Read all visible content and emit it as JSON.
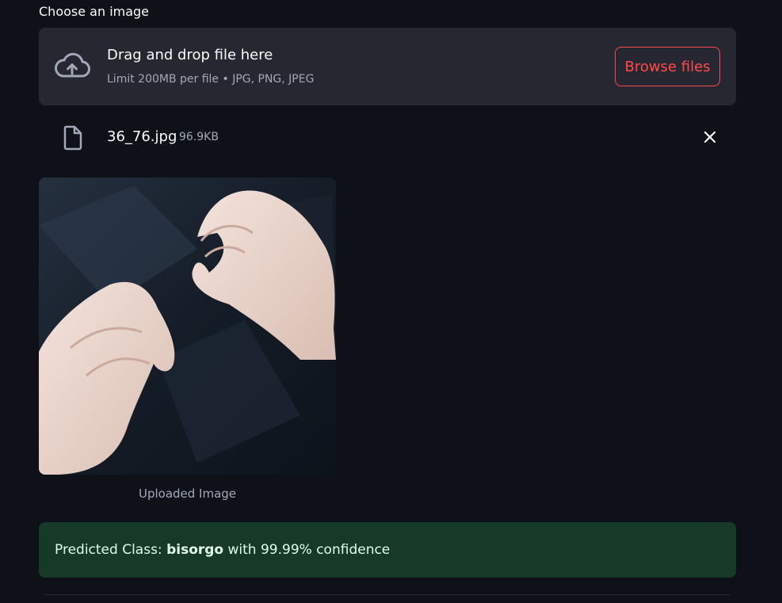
{
  "uploader": {
    "label": "Choose an image",
    "dropzone_title": "Drag and drop file here",
    "dropzone_subtitle": "Limit 200MB per file • JPG, PNG, JPEG",
    "browse_label": "Browse files",
    "accent_color": "#ff4b4b"
  },
  "file": {
    "name": "36_76.jpg",
    "size": "96.9KB",
    "icon": "file-icon",
    "remove_icon": "close-icon"
  },
  "image": {
    "caption": "Uploaded Image"
  },
  "result": {
    "prefix": "Predicted Class: ",
    "class_name": "bisorgo",
    "suffix": " with 99.99% confidence",
    "color": "#173928"
  }
}
